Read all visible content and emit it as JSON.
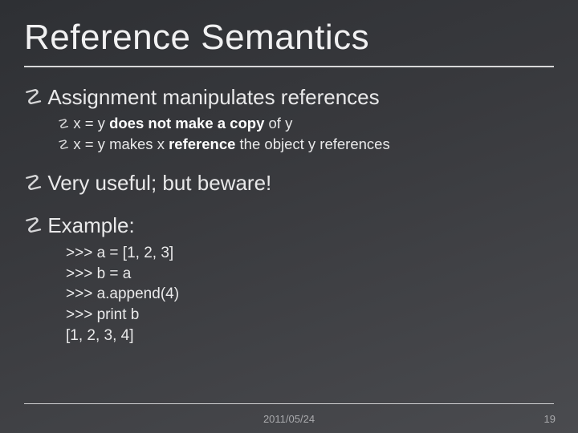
{
  "title": "Reference Semantics",
  "bullets": {
    "b1": "Assignment manipulates references",
    "b1s1_pre": "x = y ",
    "b1s1_bold": "does not make a copy",
    "b1s1_post": " of y",
    "b1s2_pre": "x = y makes x ",
    "b1s2_bold": "reference",
    "b1s2_post": " the object y references",
    "b2": "Very useful; but beware!",
    "b3": "Example:"
  },
  "code": {
    "l1": ">>> a = [1, 2, 3]",
    "l2": ">>> b = a",
    "l3": ">>> a.append(4)",
    "l4": ">>> print b",
    "l5": "[1, 2, 3, 4]"
  },
  "footer": {
    "date": "2011/05/24",
    "page": "19"
  },
  "glyphs": {
    "bullet": "☡",
    "sub": "☡"
  }
}
